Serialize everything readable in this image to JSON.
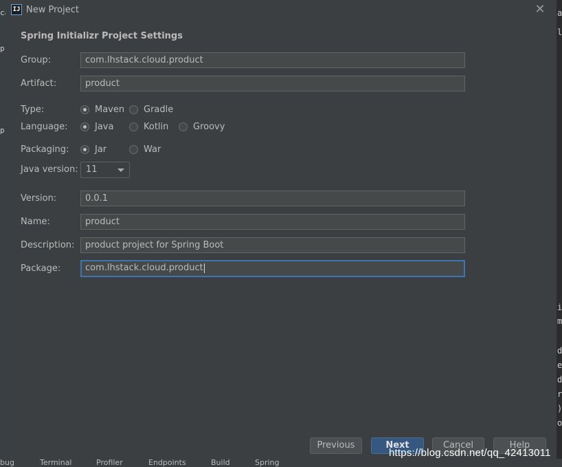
{
  "window": {
    "title": "New Project",
    "app_icon_text": "IJ",
    "close_glyph": "✕"
  },
  "section_title": "Spring Initializr Project Settings",
  "fields": {
    "group": {
      "label": "Group:",
      "value": "com.lhstack.cloud.product"
    },
    "artifact": {
      "label": "Artifact:",
      "value": "product"
    },
    "version": {
      "label": "Version:",
      "value": "0.0.1"
    },
    "name": {
      "label": "Name:",
      "value": "product"
    },
    "description": {
      "label": "Description:",
      "value": "product project for Spring Boot"
    },
    "package": {
      "label": "Package:",
      "value": "com.lhstack.cloud.product"
    }
  },
  "type": {
    "label": "Type:",
    "options": [
      "Maven",
      "Gradle"
    ],
    "selected": "Maven"
  },
  "language": {
    "label": "Language:",
    "options": [
      "Java",
      "Kotlin",
      "Groovy"
    ],
    "selected": "Java"
  },
  "packaging": {
    "label": "Packaging:",
    "options": [
      "Jar",
      "War"
    ],
    "selected": "Jar"
  },
  "java_version": {
    "label": "Java version:",
    "value": "11"
  },
  "buttons": {
    "previous": "Previous",
    "next": "Next",
    "cancel": "Cancel",
    "help": "Help"
  },
  "background": {
    "bottom_tabs": [
      "bug",
      "Terminal",
      "Profiler",
      "Endpoints",
      "Build",
      "Spring"
    ],
    "left_chars": [
      "ca",
      "p",
      "p"
    ],
    "right_chars": [
      "at",
      "le",
      "i",
      "m",
      "d",
      "e",
      "d",
      "r",
      ")",
      "o"
    ]
  },
  "watermark": "https://blog.csdn.net/qq_42413011",
  "colors": {
    "dialog_bg": "#3c3f41",
    "input_bg": "#45494a",
    "focus_border": "#3d75b2",
    "primary_button": "#365880"
  }
}
